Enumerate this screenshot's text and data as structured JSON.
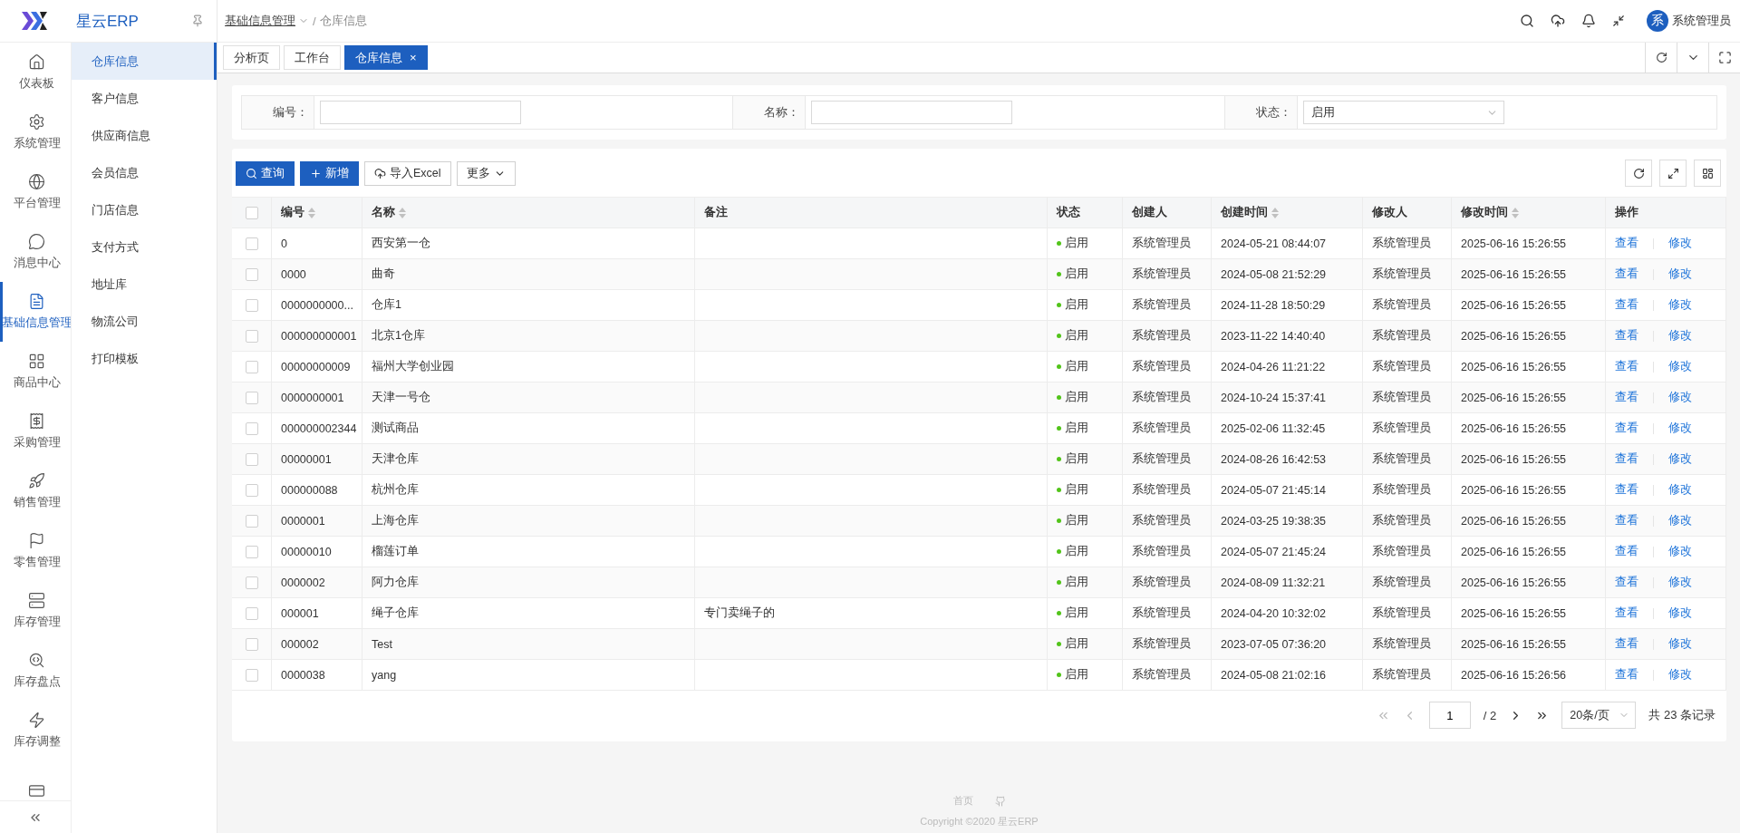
{
  "app": {
    "name": "星云ERP"
  },
  "breadcrumb": [
    {
      "label": "基础信息管理",
      "has_dropdown": true
    },
    {
      "label": "仓库信息",
      "has_dropdown": false,
      "separator": "/"
    }
  ],
  "user": {
    "avatar": "系",
    "name": "系统管理员"
  },
  "rail": [
    {
      "label": "仪表板",
      "selected": false
    },
    {
      "label": "系统管理",
      "selected": false
    },
    {
      "label": "平台管理",
      "selected": false
    },
    {
      "label": "消息中心",
      "selected": false
    },
    {
      "label": "基础信息管理",
      "selected": true
    },
    {
      "label": "商品中心",
      "selected": false
    },
    {
      "label": "采购管理",
      "selected": false
    },
    {
      "label": "销售管理",
      "selected": false
    },
    {
      "label": "零售管理",
      "selected": false
    },
    {
      "label": "库存管理",
      "selected": false
    },
    {
      "label": "库存盘点",
      "selected": false
    },
    {
      "label": "库存调整",
      "selected": false
    },
    {
      "selected": false
    }
  ],
  "submenu": [
    {
      "label": "仓库信息",
      "selected": true
    },
    {
      "label": "客户信息",
      "selected": false
    },
    {
      "label": "供应商信息",
      "selected": false
    },
    {
      "label": "会员信息",
      "selected": false
    },
    {
      "label": "门店信息",
      "selected": false
    },
    {
      "label": "支付方式",
      "selected": false
    },
    {
      "label": "地址库",
      "selected": false
    },
    {
      "label": "物流公司",
      "selected": false
    },
    {
      "label": "打印模板",
      "selected": false
    }
  ],
  "tabs": [
    {
      "label": "分析页",
      "selected": false
    },
    {
      "label": "工作台",
      "selected": false
    },
    {
      "label": "仓库信息",
      "selected": true,
      "close": "×"
    }
  ],
  "filters": [
    {
      "label": "编号：",
      "kind": "input"
    },
    {
      "label": "名称：",
      "kind": "input"
    },
    {
      "label": "状态：",
      "kind": "select",
      "value": "启用"
    }
  ],
  "toolbar": [
    {
      "label": "查询",
      "kind": "primary"
    },
    {
      "label": "新增",
      "kind": "primary"
    },
    {
      "label": "导入Excel",
      "kind": "default"
    },
    {
      "label": "更多",
      "kind": "default"
    }
  ],
  "table": {
    "all_checked": false,
    "columns": [
      {
        "label": "编号",
        "sortable": true
      },
      {
        "label": "名称",
        "sortable": true
      },
      {
        "label": "备注",
        "sortable": false
      },
      {
        "label": "状态",
        "sortable": false
      },
      {
        "label": "创建人",
        "sortable": false
      },
      {
        "label": "创建时间",
        "sortable": true
      },
      {
        "label": "修改人",
        "sortable": false
      },
      {
        "label": "修改时间",
        "sortable": true
      },
      {
        "label": "操作",
        "sortable": false
      }
    ],
    "rows": [
      {
        "checked": false,
        "cells": [
          "0",
          "西安第一仓",
          "",
          "启用",
          "系统管理员",
          "2024-05-21 08:44:07",
          "系统管理员",
          "2025-06-16 15:26:55"
        ],
        "actions": [
          "查看",
          "修改"
        ]
      },
      {
        "checked": false,
        "cells": [
          "0000",
          "曲奇",
          "",
          "启用",
          "系统管理员",
          "2024-05-08 21:52:29",
          "系统管理员",
          "2025-06-16 15:26:55"
        ],
        "actions": [
          "查看",
          "修改"
        ]
      },
      {
        "checked": false,
        "cells": [
          "0000000000...",
          "仓库1",
          "",
          "启用",
          "系统管理员",
          "2024-11-28 18:50:29",
          "系统管理员",
          "2025-06-16 15:26:55"
        ],
        "actions": [
          "查看",
          "修改"
        ]
      },
      {
        "checked": false,
        "cells": [
          "000000000001",
          "北京1仓库",
          "",
          "启用",
          "系统管理员",
          "2023-11-22 14:40:40",
          "系统管理员",
          "2025-06-16 15:26:55"
        ],
        "actions": [
          "查看",
          "修改"
        ]
      },
      {
        "checked": false,
        "cells": [
          "00000000009",
          "福州大学创业园",
          "",
          "启用",
          "系统管理员",
          "2024-04-26 11:21:22",
          "系统管理员",
          "2025-06-16 15:26:55"
        ],
        "actions": [
          "查看",
          "修改"
        ]
      },
      {
        "checked": false,
        "cells": [
          "0000000001",
          "天津一号仓",
          "",
          "启用",
          "系统管理员",
          "2024-10-24 15:37:41",
          "系统管理员",
          "2025-06-16 15:26:55"
        ],
        "actions": [
          "查看",
          "修改"
        ]
      },
      {
        "checked": false,
        "cells": [
          "000000002344",
          "测试商品",
          "",
          "启用",
          "系统管理员",
          "2025-02-06 11:32:45",
          "系统管理员",
          "2025-06-16 15:26:55"
        ],
        "actions": [
          "查看",
          "修改"
        ]
      },
      {
        "checked": false,
        "cells": [
          "00000001",
          "天津仓库",
          "",
          "启用",
          "系统管理员",
          "2024-08-26 16:42:53",
          "系统管理员",
          "2025-06-16 15:26:55"
        ],
        "actions": [
          "查看",
          "修改"
        ]
      },
      {
        "checked": false,
        "cells": [
          "000000088",
          "杭州仓库",
          "",
          "启用",
          "系统管理员",
          "2024-05-07 21:45:14",
          "系统管理员",
          "2025-06-16 15:26:55"
        ],
        "actions": [
          "查看",
          "修改"
        ]
      },
      {
        "checked": false,
        "cells": [
          "0000001",
          "上海仓库",
          "",
          "启用",
          "系统管理员",
          "2024-03-25 19:38:35",
          "系统管理员",
          "2025-06-16 15:26:55"
        ],
        "actions": [
          "查看",
          "修改"
        ]
      },
      {
        "checked": false,
        "cells": [
          "00000010",
          "榴莲订单",
          "",
          "启用",
          "系统管理员",
          "2024-05-07 21:45:24",
          "系统管理员",
          "2025-06-16 15:26:55"
        ],
        "actions": [
          "查看",
          "修改"
        ]
      },
      {
        "checked": false,
        "cells": [
          "0000002",
          "阿力仓库",
          "",
          "启用",
          "系统管理员",
          "2024-08-09 11:32:21",
          "系统管理员",
          "2025-06-16 15:26:55"
        ],
        "actions": [
          "查看",
          "修改"
        ]
      },
      {
        "checked": false,
        "cells": [
          "000001",
          "绳子仓库",
          "专门卖绳子的",
          "启用",
          "系统管理员",
          "2024-04-20 10:32:02",
          "系统管理员",
          "2025-06-16 15:26:55"
        ],
        "actions": [
          "查看",
          "修改"
        ]
      },
      {
        "checked": false,
        "cells": [
          "000002",
          "Test",
          "",
          "启用",
          "系统管理员",
          "2023-07-05 07:36:20",
          "系统管理员",
          "2025-06-16 15:26:55"
        ],
        "actions": [
          "查看",
          "修改"
        ]
      },
      {
        "checked": false,
        "cells": [
          "0000038",
          "yang",
          "",
          "启用",
          "系统管理员",
          "2024-05-08 21:02:16",
          "系统管理员",
          "2025-06-16 15:26:56"
        ],
        "actions": [
          "查看",
          "修改"
        ]
      }
    ]
  },
  "pagination": {
    "page": "1",
    "pages": "/ 2",
    "page_size": "20条/页",
    "total": "共 23 条记录"
  },
  "footer": {
    "link": "首页",
    "copyright": "Copyright ©2020 星云ERP"
  }
}
